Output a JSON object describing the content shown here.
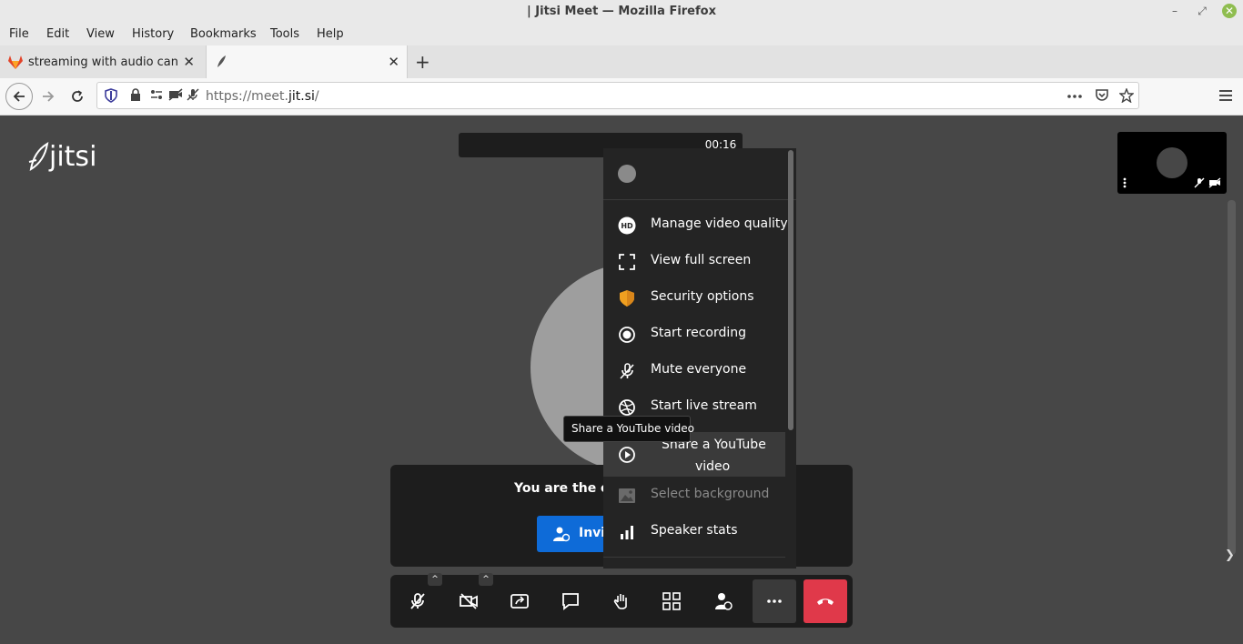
{
  "window": {
    "title": "| Jitsi Meet — Mozilla Firefox",
    "minimize": "–",
    "maximize": "⤢",
    "close": "✕"
  },
  "menubar": [
    "File",
    "Edit",
    "View",
    "History",
    "Bookmarks",
    "Tools",
    "Help"
  ],
  "tabs": [
    {
      "label": "streaming with audio cannot"
    },
    {
      "label": ""
    }
  ],
  "tab_close": "✕",
  "new_tab": "+",
  "urlbar": {
    "prefix": "https://meet.",
    "domain": "jit.si",
    "path": "/"
  },
  "page": {
    "logo": "jitsi",
    "timer": "00:16",
    "notice": "You are the onl",
    "invite_label": "Invit"
  },
  "menu": {
    "items": [
      {
        "label": "Manage video quality",
        "icon": "hd-icon"
      },
      {
        "label": "View full screen",
        "icon": "fullscreen-icon"
      },
      {
        "label": "Security options",
        "icon": "shield-icon"
      },
      {
        "label": "Start recording",
        "icon": "record-icon"
      },
      {
        "label": "Mute everyone",
        "icon": "mic-off-icon"
      },
      {
        "label": "Start live stream",
        "icon": "live-stream-icon"
      }
    ],
    "youtube_line1": "Share a YouTube",
    "youtube_line2": "video",
    "background": "Select background",
    "speaker_stats": "Speaker stats"
  },
  "tooltip": "Share a YouTube video",
  "colors": {
    "accent": "#0e6bd8",
    "hangup": "#e0394a",
    "shield": "#f0a020"
  }
}
